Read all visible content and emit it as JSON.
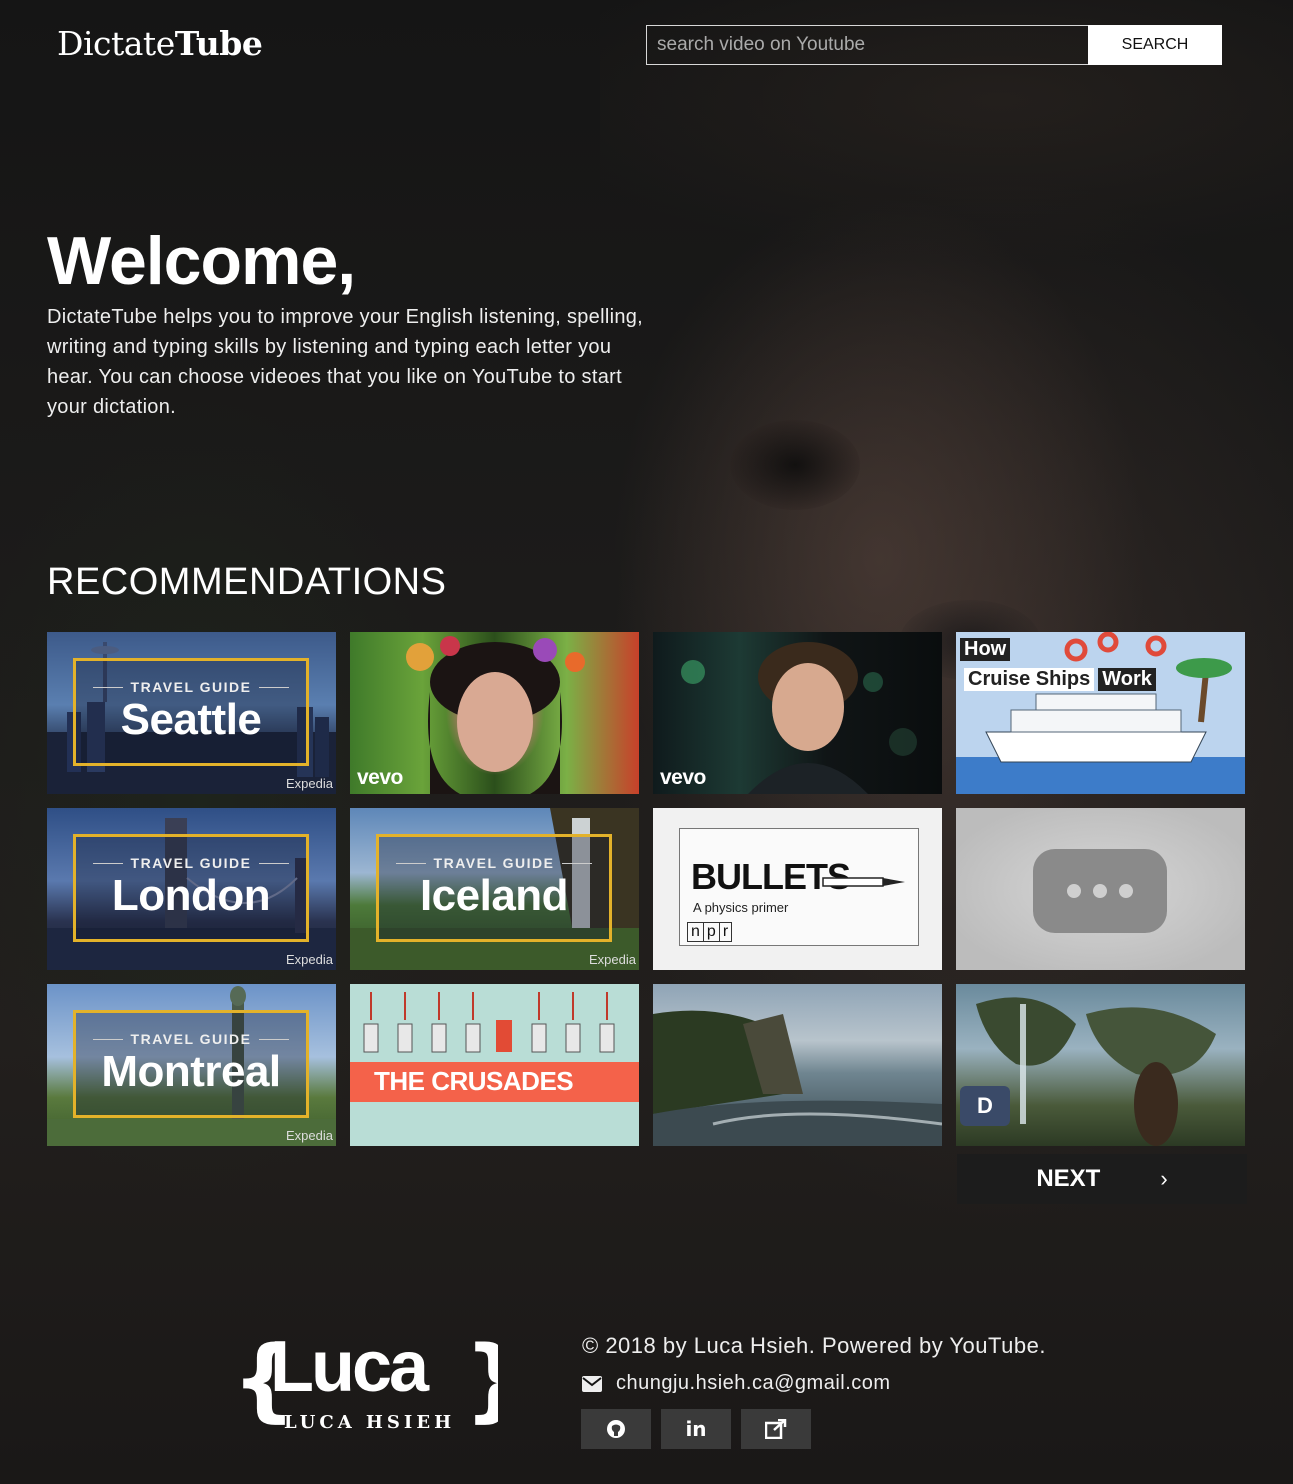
{
  "header": {
    "logo_light": "Dictate",
    "logo_bold": "Tube",
    "search_placeholder": "search video on Youtube",
    "search_button": "SEARCH"
  },
  "hero": {
    "title": "Welcome,",
    "description": "DictateTube helps you to improve your English listening, spelling, writing and typing skills by listening and typing each letter you hear. You can choose videoes that you like on YouTube to start your dictation."
  },
  "recommendations": {
    "title": "RECOMMENDATIONS",
    "travel_label": "TRAVEL GUIDE",
    "expedia_label": "Expedia",
    "vevo_label": "vevo",
    "seattle": "Seattle",
    "london": "London",
    "iceland": "Iceland",
    "montreal": "Montreal",
    "cruise_how": "How",
    "cruise_ships": "Cruise Ships",
    "cruise_work": "Work",
    "bullets_title": "BULLETS",
    "bullets_sub": "A physics primer",
    "npr": [
      "n",
      "p",
      "r"
    ],
    "crusades": "THE CRUSADES",
    "next_label": "NEXT"
  },
  "footer": {
    "logo_word": "Luca",
    "logo_name": "LUCA HSIEH",
    "copyright": "© 2018 by Luca Hsieh. Powered by YouTube.",
    "email": "chungju.hsieh.ca@gmail.com",
    "social_icons": [
      "github-icon",
      "linkedin-icon",
      "external-link-icon"
    ]
  },
  "colors": {
    "travel_frame": "#e3b22a",
    "crusades_band": "#f4624a",
    "button_dark": "#1c1c1c"
  }
}
